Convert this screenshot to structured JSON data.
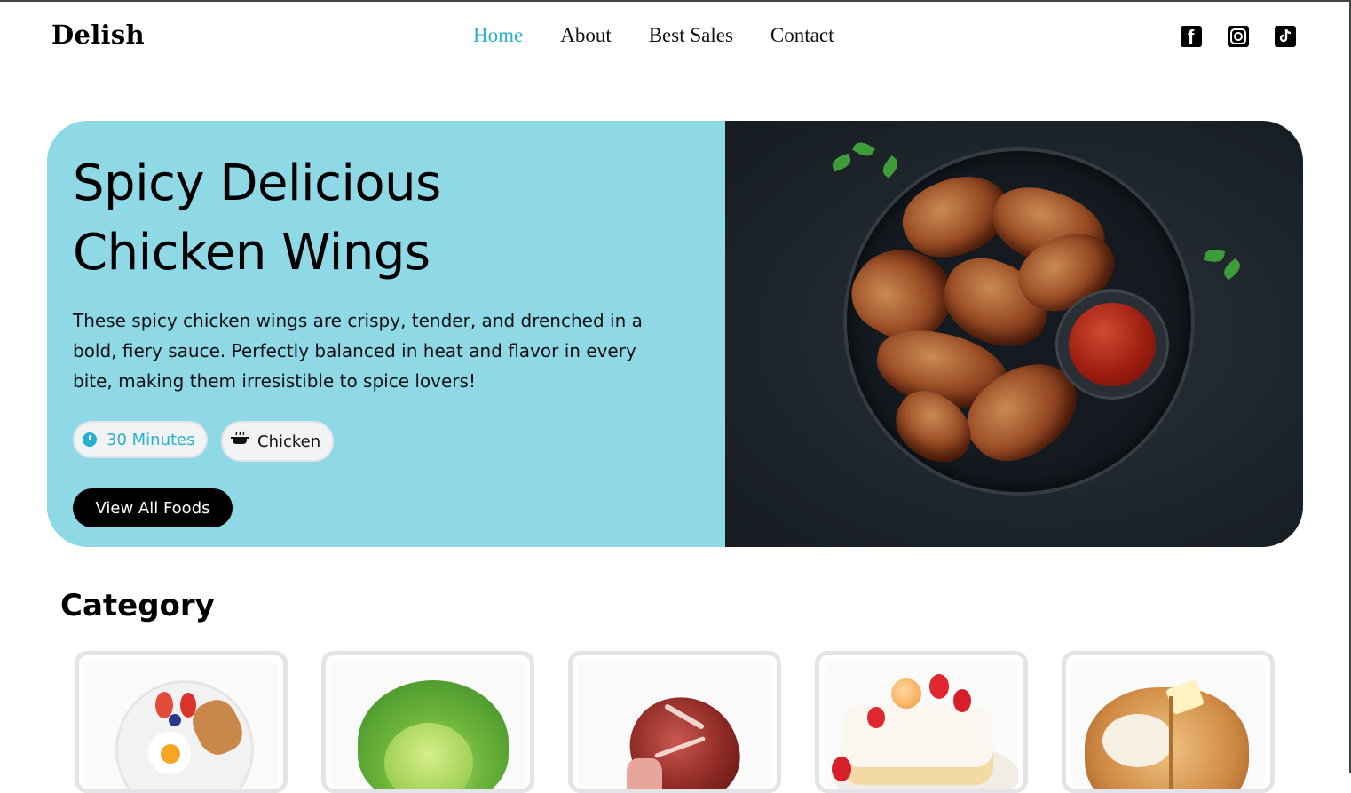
{
  "brand": {
    "logo": "Delish"
  },
  "nav": {
    "items": [
      {
        "label": "Home",
        "active": true
      },
      {
        "label": "About",
        "active": false
      },
      {
        "label": "Best Sales",
        "active": false
      },
      {
        "label": "Contact",
        "active": false
      }
    ],
    "social_icons": [
      "facebook-icon",
      "instagram-icon",
      "tiktok-icon"
    ]
  },
  "hero": {
    "title": "Spicy Delicious Chicken Wings",
    "description": "These spicy chicken wings are crispy, tender, and drenched in a bold, fiery sauce. Perfectly balanced in heat and flavor in every bite, making them irresistible to spice lovers!",
    "time_pill": "30 Minutes",
    "category_pill": "Chicken",
    "cta_label": "View All Foods",
    "image": "chicken-wings-photo"
  },
  "category": {
    "title": "Category",
    "items": [
      {
        "image": "breakfast-plate-photo"
      },
      {
        "image": "lettuce-photo"
      },
      {
        "image": "meat-photo"
      },
      {
        "image": "cake-photo"
      },
      {
        "image": "toast-photo"
      }
    ]
  },
  "colors": {
    "accent": "#27b0cf",
    "hero_bg": "#8fd8e6",
    "button_bg": "#000000"
  }
}
